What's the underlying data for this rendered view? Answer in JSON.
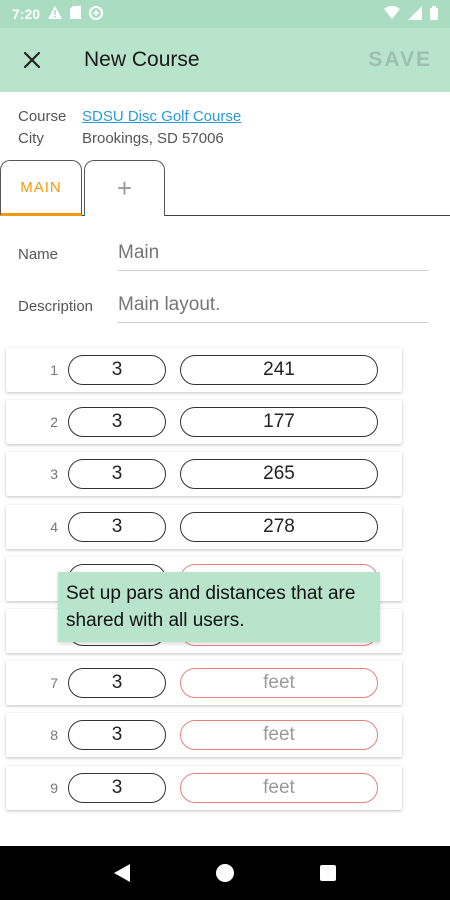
{
  "status_bar": {
    "time": "7:20"
  },
  "app_bar": {
    "title": "New Course",
    "save_label": "SAVE"
  },
  "course": {
    "course_label": "Course",
    "course_value": "SDSU Disc Golf Course",
    "city_label": "City",
    "city_value": "Brookings, SD 57006"
  },
  "tabs": {
    "main_label": "MAIN",
    "add_label": "+"
  },
  "form": {
    "name_label": "Name",
    "name_placeholder": "Main",
    "description_label": "Description",
    "description_placeholder": "Main layout."
  },
  "holes": [
    {
      "number": "1",
      "par": "3",
      "distance": "241"
    },
    {
      "number": "2",
      "par": "3",
      "distance": "177"
    },
    {
      "number": "3",
      "par": "3",
      "distance": "265"
    },
    {
      "number": "4",
      "par": "3",
      "distance": "278"
    },
    {
      "number": "",
      "par": "",
      "distance": ""
    },
    {
      "number": "",
      "par": "",
      "distance": ""
    },
    {
      "number": "7",
      "par": "3",
      "distance": "feet"
    },
    {
      "number": "8",
      "par": "3",
      "distance": "feet"
    },
    {
      "number": "9",
      "par": "3",
      "distance": "feet"
    }
  ],
  "tooltip": {
    "text": "Set up pars and distances that are shared with all users."
  },
  "colors": {
    "accent": "#f29a12",
    "app_bar": "#b7e4cb",
    "link": "#2a9ad8",
    "error_border": "#e88080"
  }
}
